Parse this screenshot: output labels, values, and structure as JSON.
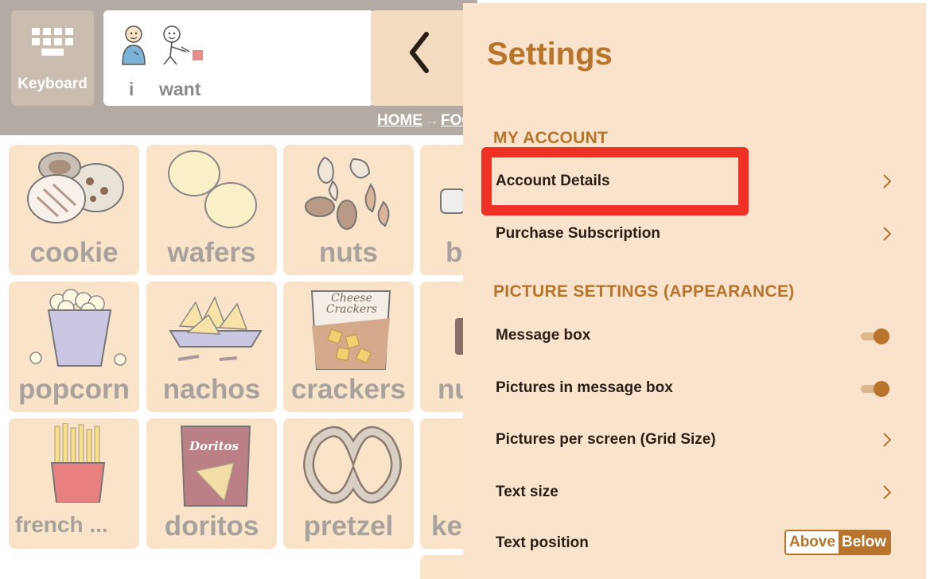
{
  "app": {
    "keyboard_label": "Keyboard",
    "message_words": [
      "i",
      "want"
    ],
    "breadcrumb": {
      "home": "HOME",
      "current": "FOO"
    },
    "tiles": [
      "cookie",
      "wafers",
      "nuts",
      "b",
      "popcorn",
      "nachos",
      "crackers",
      "nu",
      "french ...",
      "doritos",
      "pretzel",
      "ke"
    ],
    "chip_text": {
      "crackers_bag": "Cheese Crackers",
      "doritos_bag": "Doritos"
    }
  },
  "settings": {
    "title": "Settings",
    "sections": [
      {
        "heading": "MY ACCOUNT",
        "rows": [
          {
            "label": "Account Details",
            "control": "chevron"
          },
          {
            "label": "Purchase Subscription",
            "control": "chevron"
          }
        ]
      },
      {
        "heading": "PICTURE SETTINGS (APPEARANCE)",
        "rows": [
          {
            "label": "Message box",
            "control": "toggle",
            "value": true
          },
          {
            "label": "Pictures in message box",
            "control": "toggle",
            "value": true
          },
          {
            "label": "Pictures per screen (Grid Size)",
            "control": "chevron"
          },
          {
            "label": "Text size",
            "control": "chevron"
          },
          {
            "label": "Text position",
            "control": "segmented",
            "options": [
              "Above",
              "Below"
            ],
            "selected": "Below"
          }
        ]
      }
    ]
  },
  "colors": {
    "accent": "#b7742a",
    "panel": "#fae3cc",
    "tile": "#f9e4c9",
    "highlight": "#ee3124"
  },
  "icons": [
    "keyboard-icon",
    "back-chevron-icon",
    "chevron-right-icon"
  ]
}
